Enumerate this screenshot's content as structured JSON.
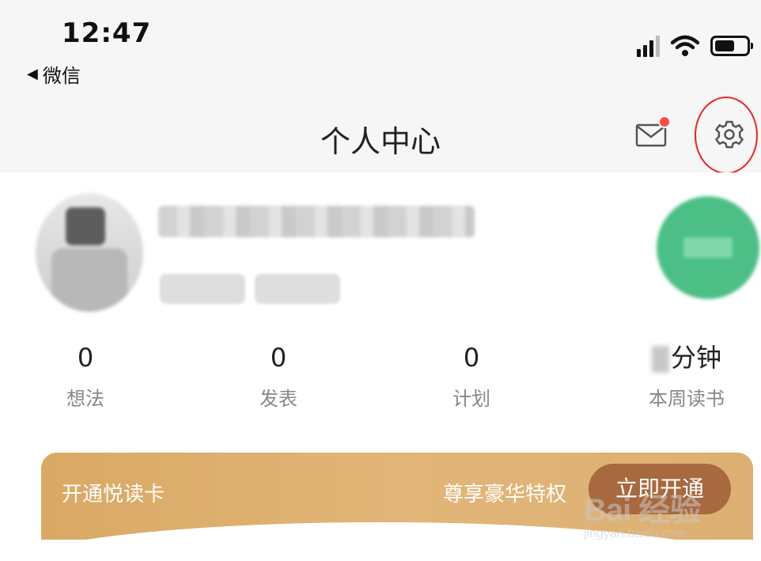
{
  "status_bar": {
    "time": "12:47",
    "back_app": "微信",
    "back_arrow": "◀"
  },
  "header": {
    "title": "个人中心",
    "icons": [
      "mail-icon",
      "gear-icon"
    ],
    "mail_has_notification": true,
    "notification_color": "#ff4a4a",
    "highlight_color": "#e22222"
  },
  "stats": [
    {
      "value": "0",
      "label": "想法"
    },
    {
      "value": "0",
      "label": "发表"
    },
    {
      "value": "0",
      "label": "计划"
    },
    {
      "value": "分钟",
      "label": "本周读书"
    }
  ],
  "vip": {
    "left_text": "开通悦读卡",
    "right_text": "尊享豪华特权",
    "button_label": "立即开通",
    "accent": "#d9a964",
    "button_color": "#a8693e"
  },
  "watermark": {
    "brand": "Bai 经验",
    "url": "jingyan.baidu.com"
  }
}
